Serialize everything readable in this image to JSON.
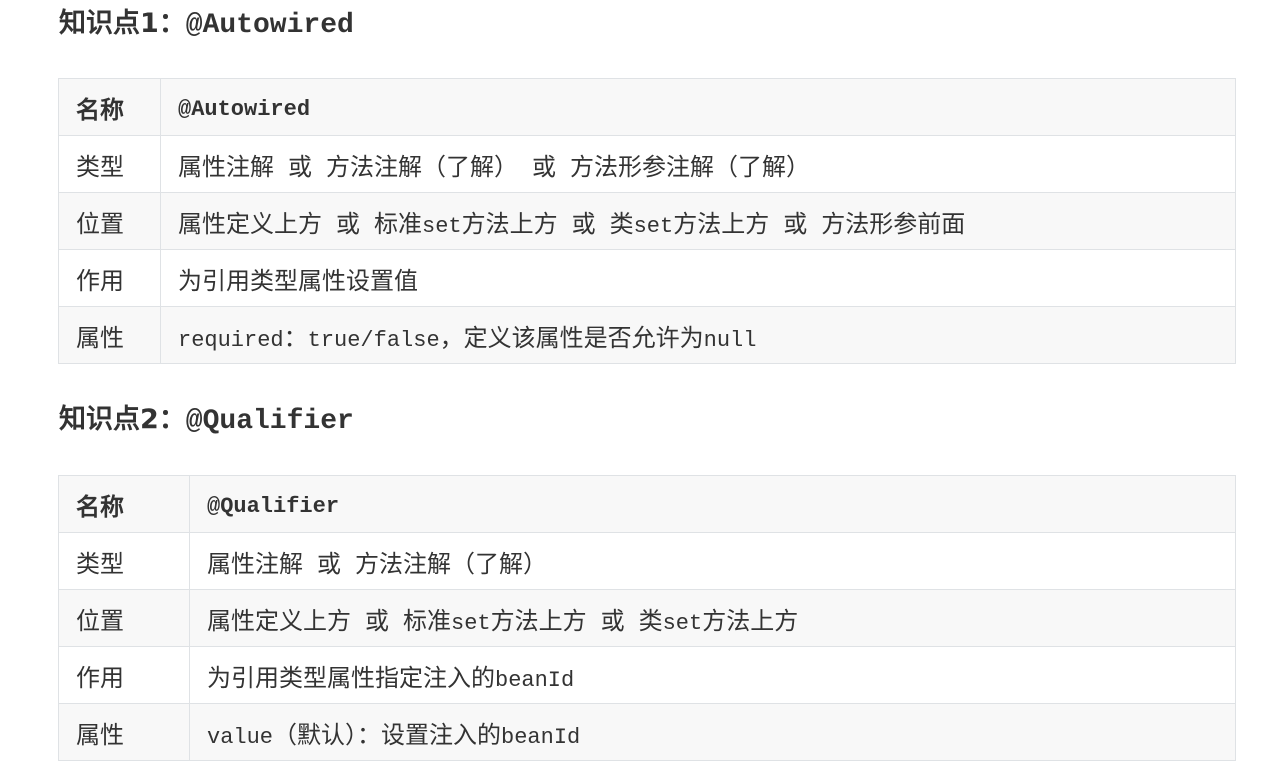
{
  "sections": [
    {
      "heading_prefix": "知识点1：",
      "heading_code": "@Autowired",
      "rows": {
        "name": {
          "label": "名称",
          "value": "@Autowired"
        },
        "type": {
          "label": "类型",
          "p1": "属性注解",
          "p2": "或",
          "p3": "方法注解（了解）",
          "p4": "或",
          "p5": "方法形参注解（了解）"
        },
        "position": {
          "label": "位置",
          "p1": "属性定义上方",
          "p2": "或",
          "p3": "标准",
          "p3code": "set",
          "p4": "方法上方",
          "p5": "或",
          "p6": "类",
          "p6code": "set",
          "p7": "方法上方",
          "p8": "或",
          "p9": "方法形参前面"
        },
        "usage": {
          "label": "作用",
          "value": "为引用类型属性设置值"
        },
        "attribute": {
          "label": "属性",
          "code1": "required",
          "sep1": "：",
          "code2": "true/false",
          "text": "，定义该属性是否允许为",
          "code3": "null"
        }
      }
    },
    {
      "heading_prefix": "知识点2：",
      "heading_code": "@Qualifier",
      "rows": {
        "name": {
          "label": "名称",
          "value": "@Qualifier"
        },
        "type": {
          "label": "类型",
          "p1": "属性注解",
          "p2": "或",
          "p3": "方法注解（了解）"
        },
        "position": {
          "label": "位置",
          "p1": "属性定义上方",
          "p2": "或",
          "p3": "标准",
          "p3code": "set",
          "p4": "方法上方",
          "p5": "或",
          "p6": "类",
          "p6code": "set",
          "p7": "方法上方"
        },
        "usage": {
          "label": "作用",
          "text": "为引用类型属性指定注入的",
          "code": "beanId"
        },
        "attribute": {
          "label": "属性",
          "code1": "value",
          "text1": "（默认）：设置注入的",
          "code2": "beanId"
        }
      }
    }
  ]
}
